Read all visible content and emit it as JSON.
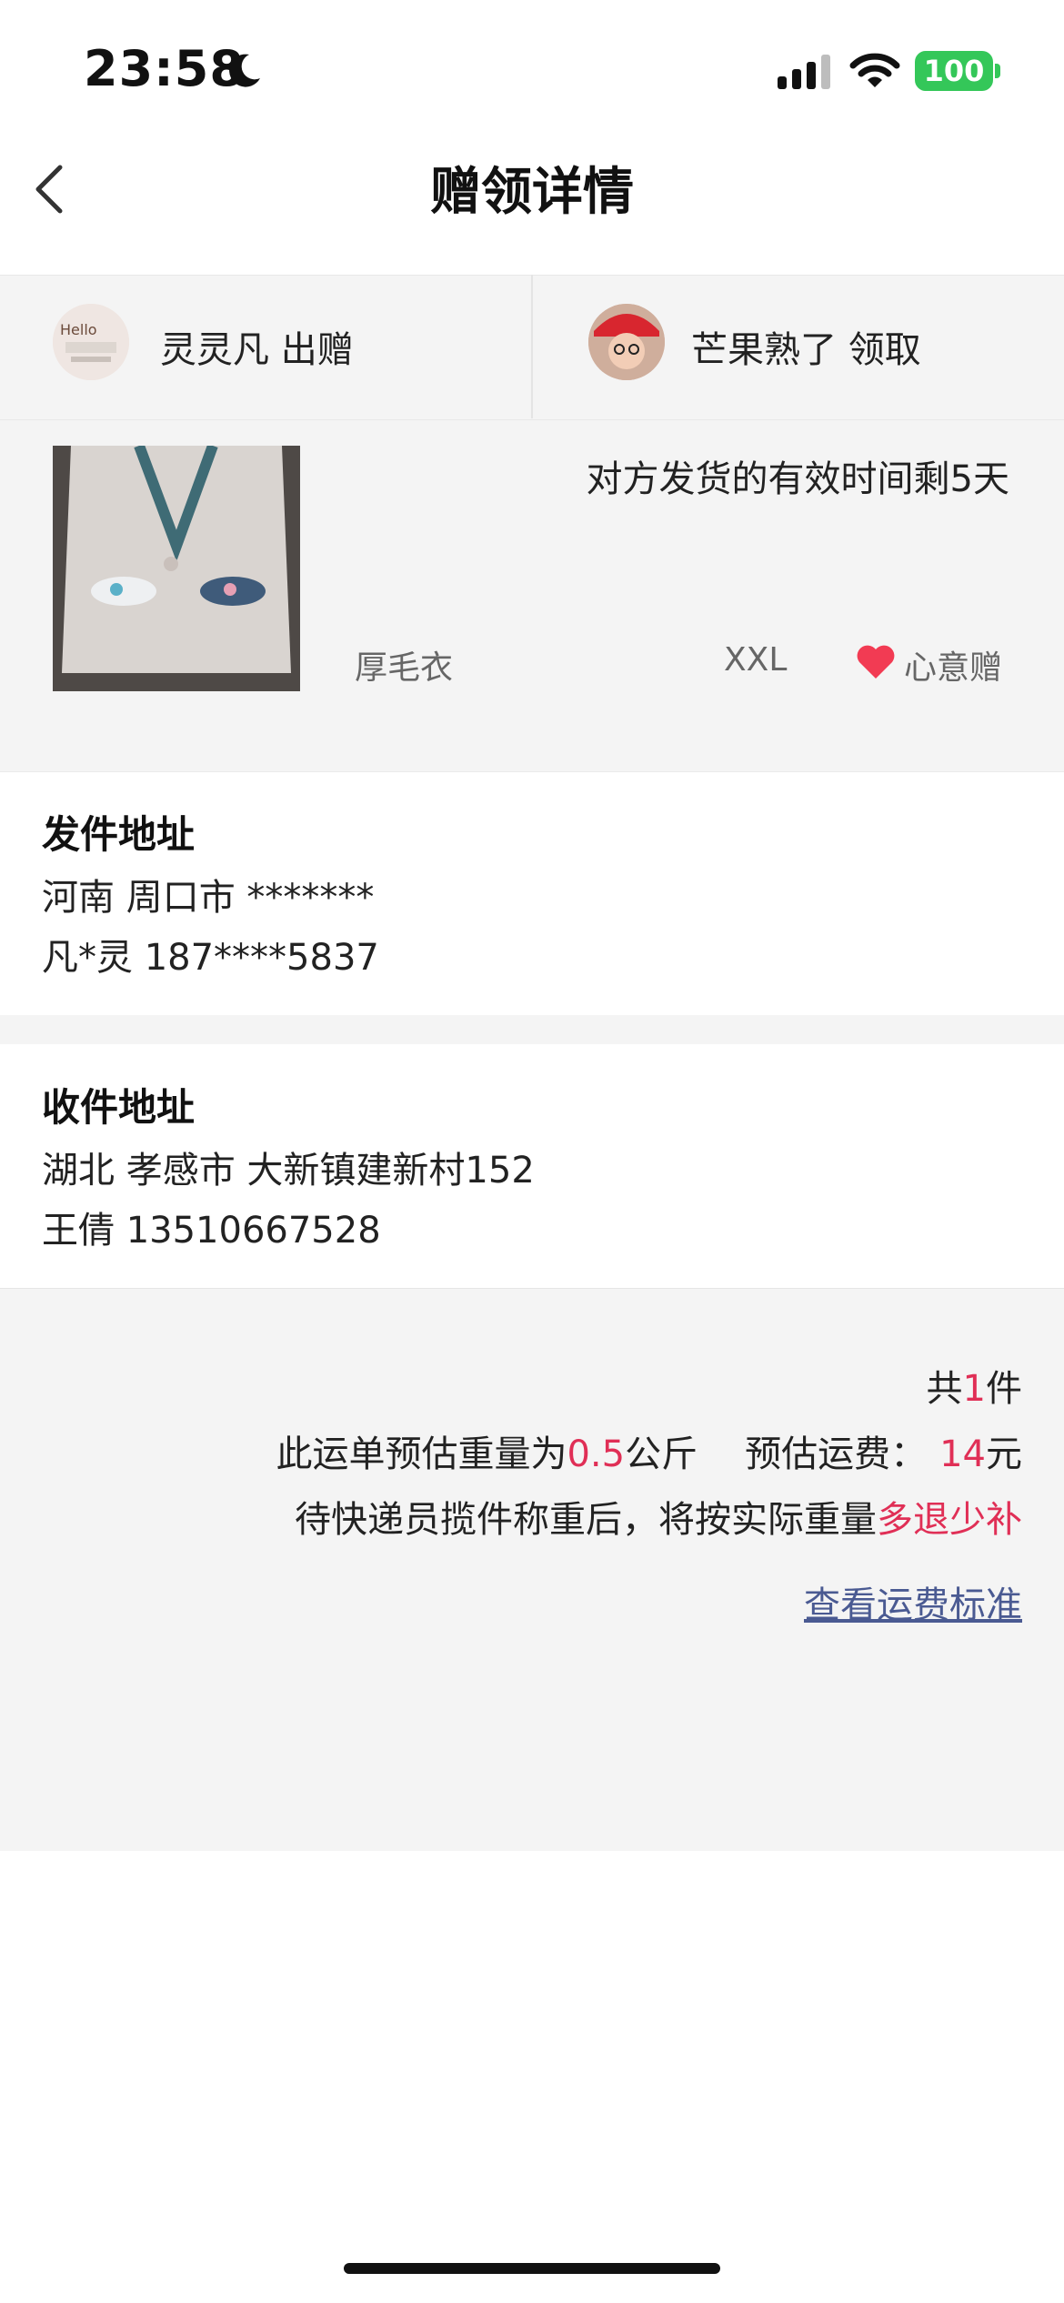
{
  "status_bar": {
    "time": "23:58",
    "battery": "100"
  },
  "nav": {
    "title": "赠领详情"
  },
  "users": {
    "giver": "灵灵凡 出赠",
    "receiver": "芒果熟了 领取"
  },
  "product": {
    "remaining_text": "对方发货的有效时间剩5天",
    "name": "厚毛衣",
    "size": "XXL",
    "tag": "心意赠"
  },
  "sender": {
    "title": "发件地址",
    "address": "河南 周口市 *******",
    "contact": "凡*灵 187****5837"
  },
  "receiver": {
    "title": "收件地址",
    "address": "湖北 孝感市 大新镇建新村152",
    "contact": "王倩 13510667528"
  },
  "summary": {
    "count_prefix": "共",
    "count": "1",
    "count_suffix": "件",
    "weight_prefix": "此运单预估重量为",
    "weight": "0.5",
    "weight_unit": "公斤",
    "fee_prefix": "预估运费：",
    "fee": "14",
    "fee_unit": "元",
    "note_prefix": "待快递员揽件称重后，将按实际重量",
    "note_highlight": "多退少补",
    "link": "查看运费标准"
  },
  "colors": {
    "accent_red": "#e02f56",
    "link_blue": "#4a5a92",
    "heart_red": "#f23b53",
    "battery_green": "#34c759"
  }
}
